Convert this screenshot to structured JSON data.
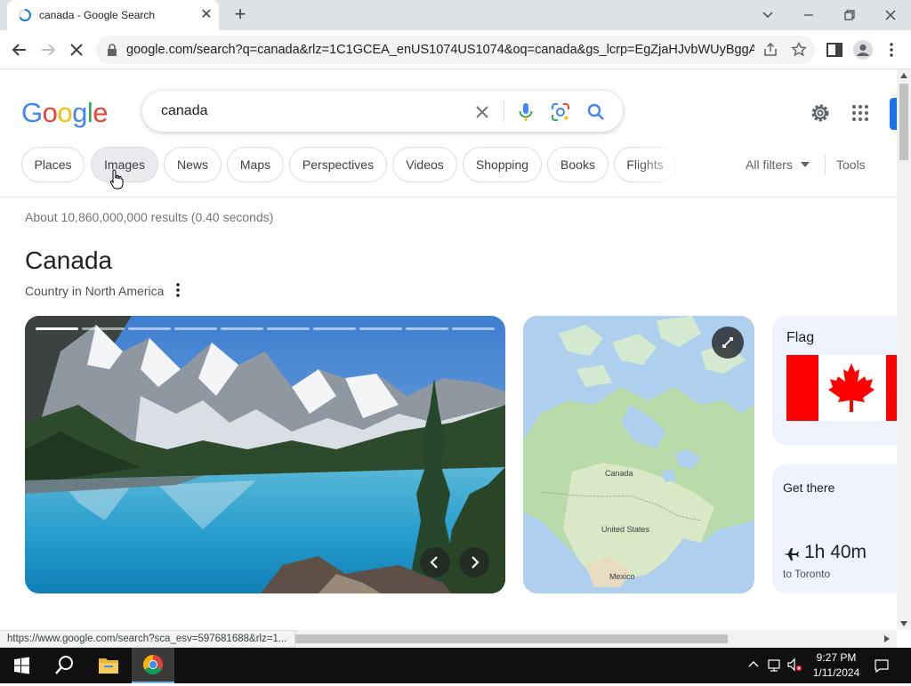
{
  "browser": {
    "tab_title": "canada - Google Search",
    "url": "google.com/search?q=canada&rlz=1C1GCEA_enUS1074US1074&oq=canada&gs_lcrp=EgZjaHJvbWUyBggAEEU..."
  },
  "search": {
    "logo": "Google",
    "query": "canada"
  },
  "filters": {
    "chips": [
      "Places",
      "Images",
      "News",
      "Maps",
      "Perspectives",
      "Videos",
      "Shopping",
      "Books",
      "Flights"
    ],
    "all_filters": "All filters",
    "tools": "Tools"
  },
  "results": {
    "stats": "About 10,860,000,000 results (0.40 seconds)"
  },
  "knowledge_panel": {
    "title": "Canada",
    "subtitle": "Country in North America",
    "map_labels": [
      "Canada",
      "United States",
      "Mexico"
    ],
    "flag_label": "Flag",
    "get_there": {
      "label": "Get there",
      "duration": "1h 40m",
      "destination": "to Toronto"
    },
    "carousel": {
      "total": 10,
      "current": 1
    }
  },
  "status_bar": {
    "url": "https://www.google.com/search?sca_esv=597681688&rlz=1..."
  },
  "taskbar": {
    "time": "9:27 PM",
    "date": "1/11/2024"
  },
  "colors": {
    "google_blue": "#4285F4",
    "google_red": "#EA4335",
    "google_yellow": "#FBBC05",
    "google_green": "#34A853",
    "flag_red": "#FF0000"
  }
}
